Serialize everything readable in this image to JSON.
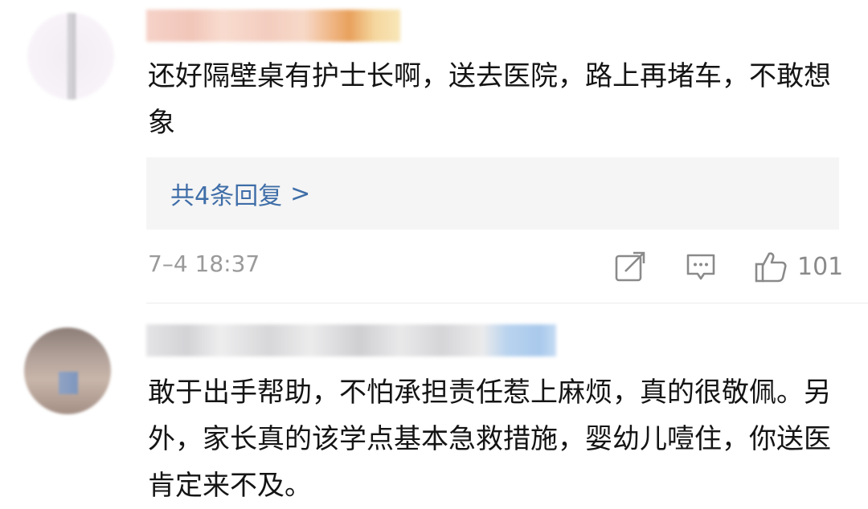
{
  "comments": [
    {
      "text": "还好隔壁桌有护士长啊，送去医院，路上再堵车，不敢想象",
      "replies_label": "共4条回复",
      "replies_chevron": ">",
      "timestamp": "7–4 18:37",
      "likes": "101"
    },
    {
      "text": "敢于出手帮助，不怕承担责任惹上麻烦，真的很敬佩。另外，家长真的该学点基本急救措施，婴幼儿噎住，你送医肯定来不及。"
    }
  ],
  "icons": {
    "share": "share-icon",
    "reply": "comment-icon",
    "like": "thumbs-up-icon"
  },
  "colors": {
    "link": "#3f6ea8",
    "text": "#141414",
    "meta": "#9a9a9a",
    "reply_bg": "#f5f5f5"
  }
}
